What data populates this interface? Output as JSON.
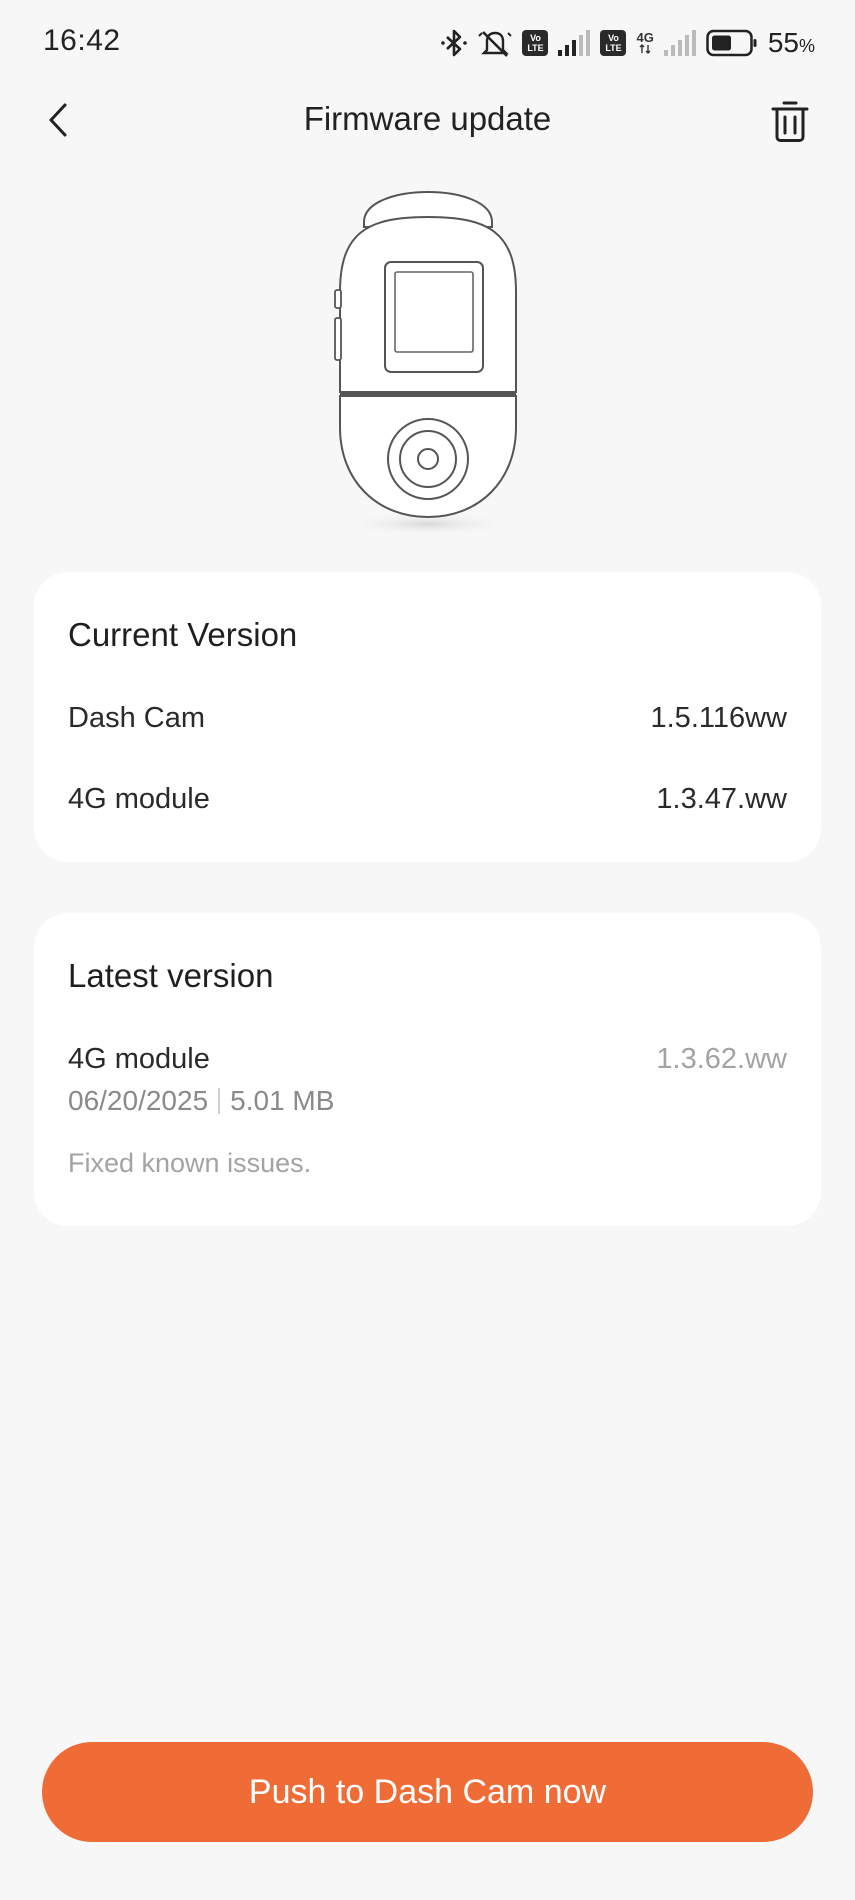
{
  "status_bar": {
    "time": "16:42",
    "network_label": "4G",
    "lte_badge": "Vo LTE",
    "battery_percent": "55",
    "battery_unit": "%",
    "icons": [
      "bluetooth-icon",
      "mute-icon",
      "volte-icon",
      "signal-icon",
      "battery-icon"
    ]
  },
  "header": {
    "title": "Firmware update",
    "back_icon": "chevron-left-icon",
    "delete_icon": "trash-icon"
  },
  "device_image": {
    "icon": "dash-cam-illustration"
  },
  "current_version": {
    "title": "Current Version",
    "rows": [
      {
        "label": "Dash Cam",
        "value": "1.5.116ww"
      },
      {
        "label": "4G module",
        "value": "1.3.47.ww"
      }
    ]
  },
  "latest_version": {
    "title": "Latest version",
    "module": "4G module",
    "version": "1.3.62.ww",
    "date": "06/20/2025",
    "size": "5.01 MB",
    "notes": "Fixed known issues."
  },
  "actions": {
    "push_label": "Push to Dash Cam now",
    "accent_color": "#ef6c36"
  }
}
